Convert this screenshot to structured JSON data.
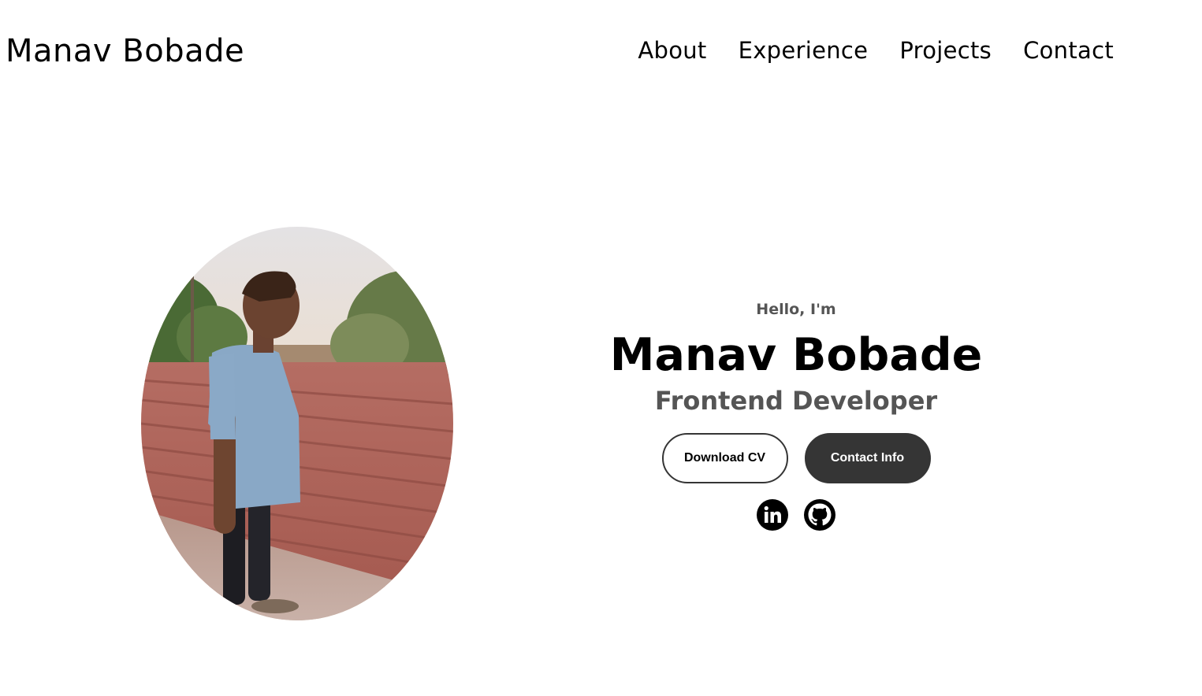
{
  "nav": {
    "logo": "Manav Bobade",
    "links": [
      {
        "label": "About"
      },
      {
        "label": "Experience"
      },
      {
        "label": "Projects"
      },
      {
        "label": "Contact"
      }
    ]
  },
  "hero": {
    "greeting": "Hello, I'm",
    "name": "Manav Bobade",
    "title": "Frontend Developer",
    "buttons": {
      "download": "Download CV",
      "contact": "Contact Info"
    },
    "social": [
      {
        "icon": "linkedin-icon"
      },
      {
        "icon": "github-icon"
      }
    ],
    "profile_image": "profile-photo"
  },
  "colors": {
    "text": "#000000",
    "muted": "#555555",
    "button_dark": "#353535"
  }
}
